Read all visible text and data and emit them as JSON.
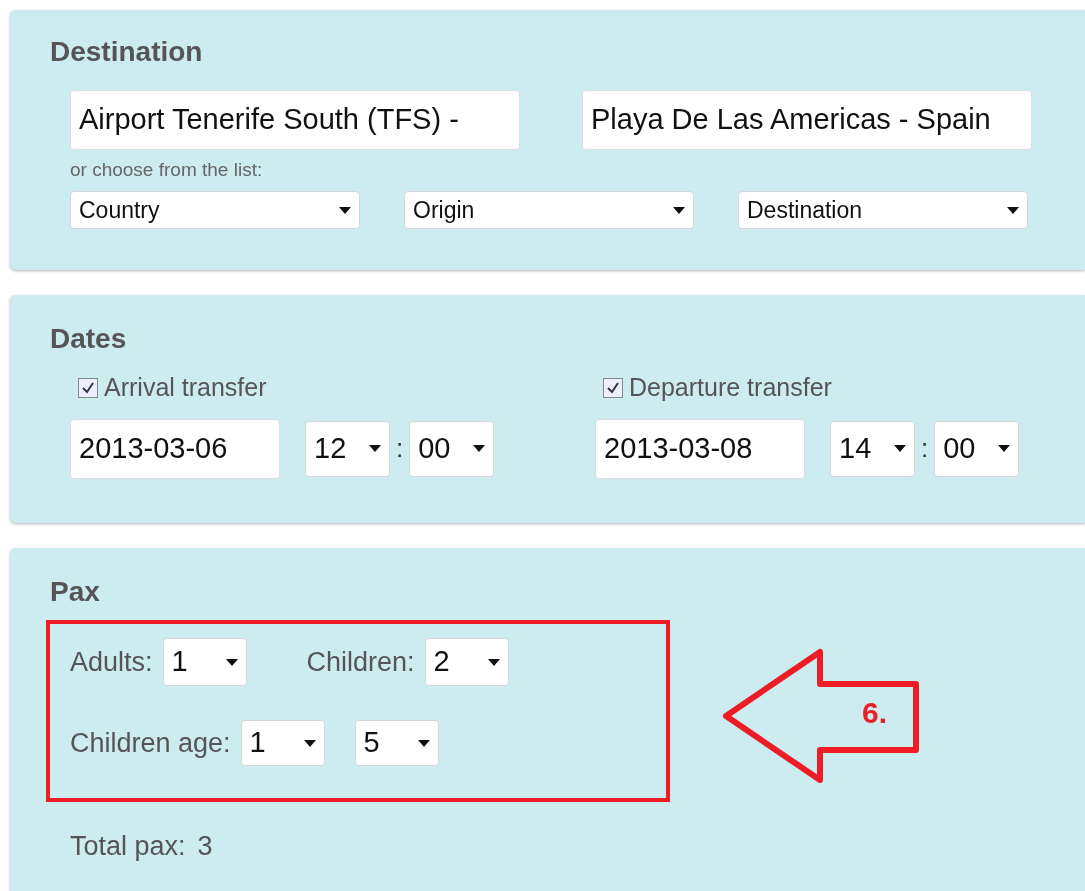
{
  "destination": {
    "title": "Destination",
    "from_value": "Airport Tenerife South (TFS) -",
    "to_value": "Playa De Las Americas - Spain",
    "hint": "or choose from the list:",
    "selects": [
      "Country",
      "Origin",
      "Destination"
    ]
  },
  "dates": {
    "title": "Dates",
    "transfers": [
      {
        "label": "Arrival transfer",
        "checked": true,
        "date": "2013-03-06",
        "hour": "12",
        "separator": ":",
        "minute": "00"
      },
      {
        "label": "Departure transfer",
        "checked": true,
        "date": "2013-03-08",
        "hour": "14",
        "separator": ":",
        "minute": "00"
      }
    ]
  },
  "pax": {
    "title": "Pax",
    "adults_label": "Adults:",
    "adults": "1",
    "children_label": "Children:",
    "children": "2",
    "age_label": "Children age:",
    "ages": [
      "1",
      "5"
    ],
    "total_label": "Total pax:",
    "total": "3"
  },
  "annotation": {
    "label": "6."
  }
}
